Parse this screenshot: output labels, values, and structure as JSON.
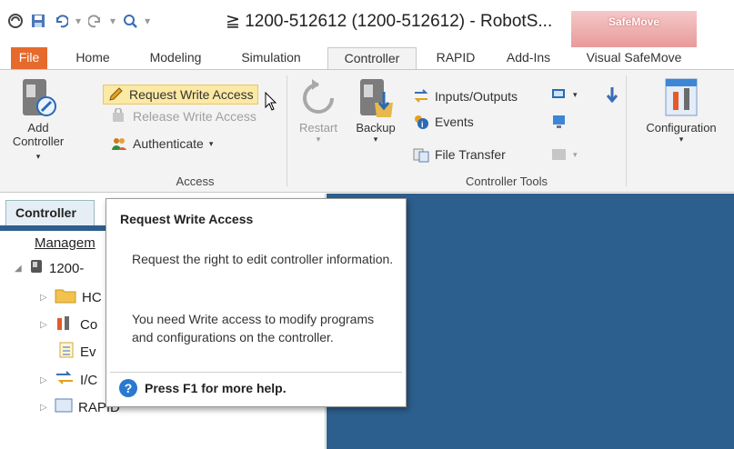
{
  "window": {
    "title": "≧ 1200-512612 (1200-512612) - RobotS...",
    "context_tab": "SafeMove"
  },
  "tabs": [
    "File",
    "Home",
    "Modeling",
    "Simulation",
    "Controller",
    "RAPID",
    "Add-Ins",
    "Visual SafeMove"
  ],
  "ribbon": {
    "add_controller": {
      "line1": "Add",
      "line2": "Controller"
    },
    "access": {
      "request_write": "Request Write Access",
      "release_write": "Release Write Access",
      "authenticate": "Authenticate",
      "label": "Access"
    },
    "restart": "Restart",
    "backup": "Backup",
    "tools": {
      "inputs_outputs": "Inputs/Outputs",
      "events": "Events",
      "file_transfer": "File Transfer",
      "label": "Controller Tools"
    },
    "configuration": "Configuration"
  },
  "left_pane": {
    "tab": "Controller",
    "items": [
      "Managem",
      "1200-",
      "HC",
      "Co",
      "Ev",
      "I/C",
      "RAPID"
    ]
  },
  "tooltip": {
    "title": "Request Write Access",
    "para1": "Request the right to edit controller information.",
    "para2": "You need Write access to modify programs and configurations on the controller.",
    "help": "Press F1 for more help."
  }
}
